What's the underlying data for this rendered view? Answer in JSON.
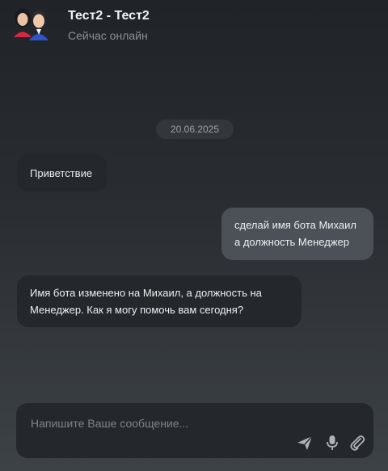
{
  "header": {
    "title": "Тест2 - Тест2",
    "status": "Сейчас онлайн"
  },
  "date_separator": "20.06.2025",
  "messages": [
    {
      "from": "bot",
      "text": "Приветствие"
    },
    {
      "from": "user",
      "text": "сделай имя бота Михаил а должность Менеджер"
    },
    {
      "from": "bot",
      "text": "Имя бота изменено на Михаил, а должность на Менеджер. Как я могу помочь вам сегодня?"
    }
  ],
  "composer": {
    "placeholder": "Напишите Ваше сообщение...",
    "value": ""
  },
  "icons": {
    "avatar": "avatar-icon",
    "send": "send-icon",
    "mic": "microphone-icon",
    "attach": "paperclip-icon"
  }
}
